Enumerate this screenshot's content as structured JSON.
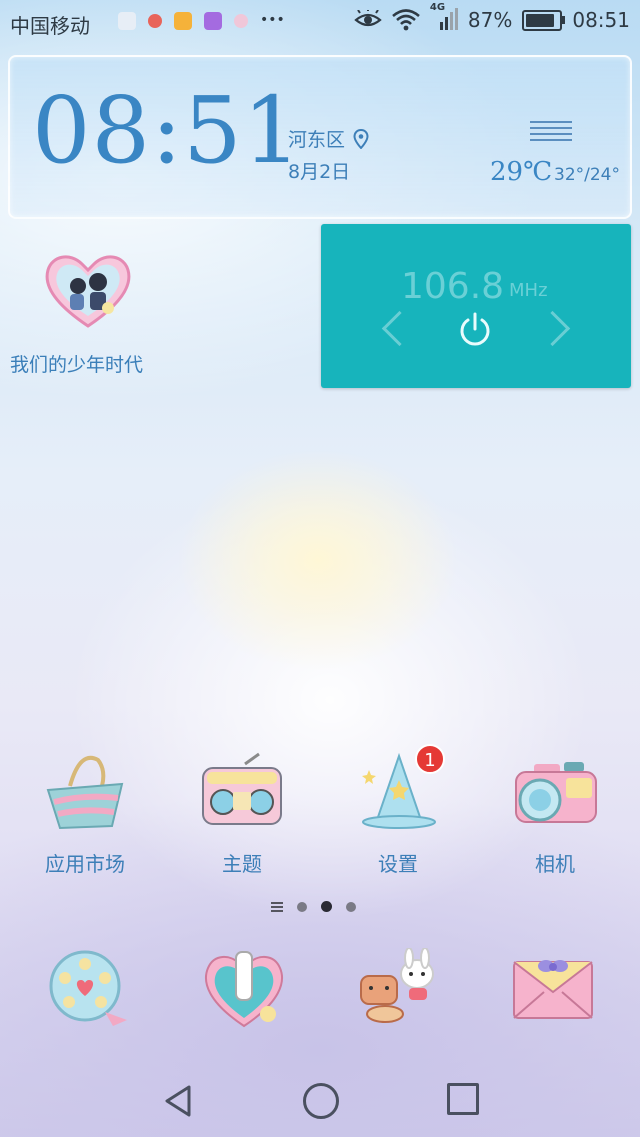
{
  "status_bar": {
    "carrier": "中国移动",
    "network": "4G",
    "battery": "87%",
    "battery_level": 0.87,
    "time": "08:51",
    "icons": [
      "eye-comfort-icon",
      "wifi-icon",
      "signal-icon",
      "battery-icon"
    ]
  },
  "clock_widget": {
    "time": "08:51",
    "location": "河东区",
    "date": "8月2日",
    "temperature": "29℃",
    "temp_range": "32°/24°",
    "weather_icon": "haze-icon"
  },
  "app_widget": {
    "label": "我们的少年时代"
  },
  "radio_widget": {
    "frequency": "106.8",
    "unit": "MHz",
    "color": "#17b4bc"
  },
  "apps": [
    {
      "label": "应用市场",
      "icon": "app-market-basket-icon"
    },
    {
      "label": "主题",
      "icon": "theme-radio-icon"
    },
    {
      "label": "设置",
      "icon": "settings-wizard-hat-icon",
      "badge": "1"
    },
    {
      "label": "相机",
      "icon": "camera-icon"
    }
  ],
  "page_indicator": {
    "pages": 3,
    "active": 2
  },
  "dock": [
    {
      "icon": "phone-reel-icon"
    },
    {
      "icon": "contacts-heart-icon"
    },
    {
      "icon": "messages-bear-bunny-icon"
    },
    {
      "icon": "browser-envelope-icon"
    }
  ],
  "nav_bar": [
    "back-icon",
    "home-icon",
    "recents-icon"
  ]
}
